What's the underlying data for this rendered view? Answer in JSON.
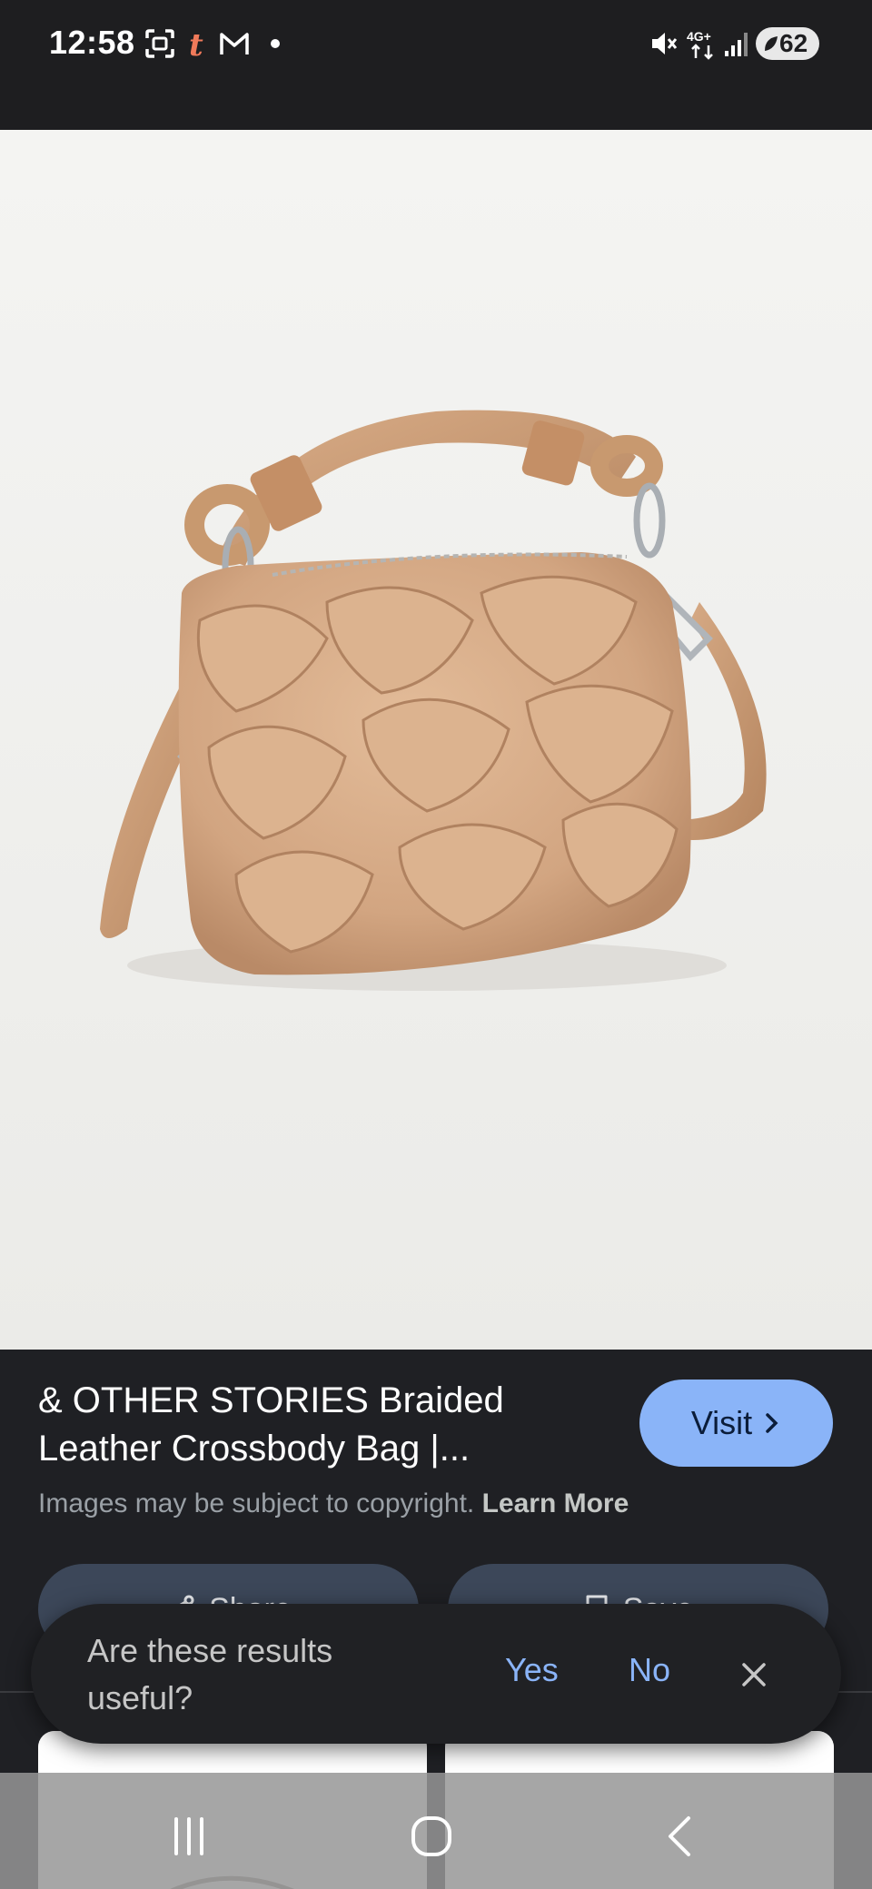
{
  "status_bar": {
    "time": "12:58",
    "left_icons": [
      "screenshot-icon",
      "t-app-icon",
      "gmail-icon",
      "notification-dot-icon"
    ],
    "right_icons": [
      "mute-icon",
      "4g-icon",
      "signal-icon",
      "battery-icon"
    ],
    "network_label": "4G+",
    "battery": "62"
  },
  "image": {
    "subject": "braided-leather-crossbody-bag",
    "background_color": "#eeeeec",
    "bag_color": "#d4a985"
  },
  "info": {
    "title": "& OTHER STORIES Braided Leather Crossbody Bag |...",
    "visit_label": "Visit",
    "copyright_text": "Images may be subject to copyright.",
    "learn_more": "Learn More",
    "share_label": "Share",
    "save_label": "Save"
  },
  "feedback": {
    "question": "Are these results useful?",
    "yes": "Yes",
    "no": "No"
  },
  "colors": {
    "accent": "#8ab4f8",
    "panel": "#1f2024",
    "action_button": "#3c4759"
  }
}
